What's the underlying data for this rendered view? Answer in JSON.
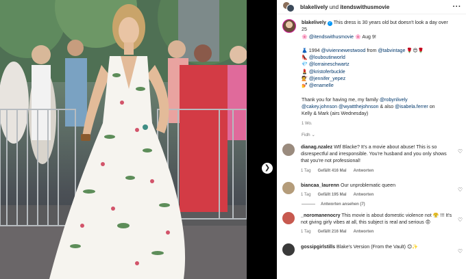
{
  "header": {
    "user1": "blakelively",
    "und": "und",
    "user2": "itendswithusmovie",
    "more_icon": "more-dots-icon"
  },
  "caption": {
    "username": "blakelively",
    "text": "This dress is 30 years old but doesn't look a day over 25",
    "line2_mention": "@itendswithusmovie",
    "line2_date": "Aug 9!",
    "credits": [
      {
        "emoji": "👗",
        "prefix": "1994 ",
        "mention": "@viviennewestwood",
        "mid": " from ",
        "mention2": "@tabvintage",
        "suffix": " 🌹😍🌹"
      },
      {
        "emoji": "👠",
        "prefix": "",
        "mention": "@louboutinworld",
        "mid": "",
        "mention2": "",
        "suffix": ""
      },
      {
        "emoji": "💎",
        "prefix": "",
        "mention": "@lorraineschwartz",
        "mid": "",
        "mention2": "",
        "suffix": ""
      },
      {
        "emoji": "💄",
        "prefix": "",
        "mention": "@kristoferbuckle",
        "mid": "",
        "mention2": "",
        "suffix": ""
      },
      {
        "emoji": "💇",
        "prefix": "",
        "mention": "@jennifer_yepez",
        "mid": "",
        "mention2": "",
        "suffix": ""
      },
      {
        "emoji": "💅",
        "prefix": "",
        "mention": "@enamelle",
        "mid": "",
        "mention2": "",
        "suffix": ""
      }
    ],
    "thanks_a": "Thank you for having me, my family ",
    "thanks_m1": "@robynlively",
    "thanks_m2": "@cakey.johnson",
    "thanks_m3": "@wyattthejohnson",
    "thanks_and": " & also ",
    "thanks_m4": "@isabela.ferrer",
    "thanks_on": " on",
    "thanks_end": "Kelly & Mark (airs Wednesday)",
    "time": "1 Wo.",
    "translate": "Fidh ⌄"
  },
  "comments": [
    {
      "username": "dianag.nzalez",
      "text": "Wtf Blacke? It's a movie about abuse! This is so disrespectful and irresponsible. You're husband and you only shows that you're not professional!",
      "time": "1 Tag",
      "likes": "Gefällt 416 Mal",
      "reply": "Antworten",
      "avatar_color": "#9a8b7e"
    },
    {
      "username": "biancaa_laurenn",
      "text": "Our unproblematic queen",
      "time": "1 Tag",
      "likes": "Gefällt 195 Mal",
      "reply": "Antworten",
      "avatar_color": "#b49c7a",
      "view_replies": "Antworten ansehen (7)"
    },
    {
      "username": "_noromanenocry",
      "text": "This movie is about domestic violence not 😤 !!! It's not giving girly vibes at all, this subject is real and serious 😡",
      "time": "1 Tag",
      "likes": "Gefällt 216 Mal",
      "reply": "Antworten",
      "avatar_color": "#c7594f"
    },
    {
      "username": "gossipgirlstills",
      "text": "Blake's Version (From the Vault) 😉✨",
      "time": "",
      "likes": "",
      "reply": "",
      "avatar_color": "#3a3a3a"
    }
  ],
  "colors": {
    "accent": "#0095f6",
    "link": "#00376b",
    "muted": "#737373"
  }
}
